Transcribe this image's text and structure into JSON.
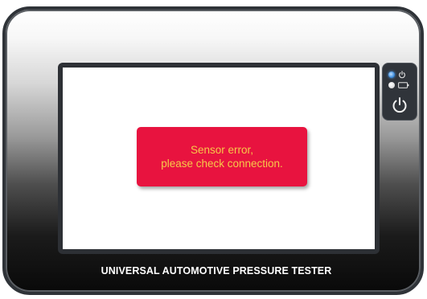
{
  "device": {
    "label": "UNIVERSAL AUTOMOTIVE PRESSURE TESTER",
    "indicators": {
      "power_led_color": "#3f8fe0",
      "power_led_icon": "power-icon",
      "battery_led_color": "#e0e0e0",
      "battery_led_icon": "battery-icon"
    },
    "power_button_icon": "power-icon"
  },
  "screen": {
    "error_message": {
      "line1": "Sensor error,",
      "line2": "please check connection.",
      "background": "#e8133f",
      "text_color": "#f7c948"
    }
  }
}
